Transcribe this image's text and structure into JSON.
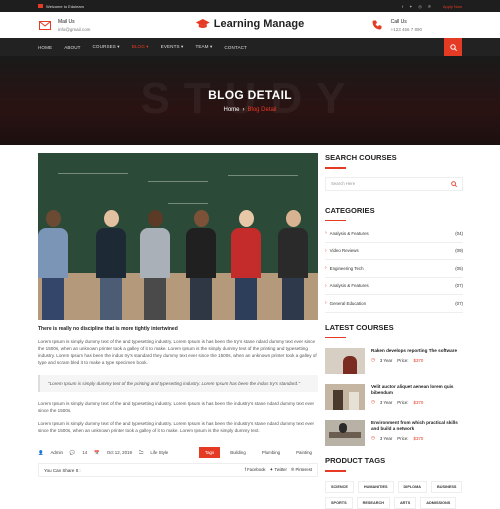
{
  "topbar": {
    "welcome": "Welcome to Eduleam",
    "apply": "Apply Now",
    "social_icons": [
      "facebook-icon",
      "twitter-icon",
      "instagram-icon",
      "pinterest-icon"
    ]
  },
  "header": {
    "mail_label": "Mail Us",
    "mail_value": "info@gmail.com",
    "logo": "Learning Manage",
    "call_label": "Call Us",
    "call_value": "+123 456 7 890"
  },
  "nav": {
    "items": [
      "HOME",
      "ABOUT",
      "COURSES ▾",
      "BLOG ▾",
      "EVENTS ▾",
      "TEAM ▾",
      "CONTACT"
    ],
    "active_index": 3
  },
  "hero": {
    "ghost": "STUDY",
    "title": "BLOG DETAIL",
    "crumb_home": "Home",
    "crumb_sep": "›",
    "crumb_current": "Blog Detail"
  },
  "post": {
    "title": "There is really no discipline that is more tightly intertwined",
    "p1": "Lorem Ipsum is simply dummy text of the and typesetting industry. Lorem Ipsum is has been the try's stane ndard dummy text ever since the 1500s, when an unknown printer took a galley of it to make. Lorem Ipsum is the simply dummy text of the printing and typesetting industry. Lorem Ipsum has been the indus try's standard they dummy text ever since the 1500s, when an unknown printer took a galley of type and scram bled it to make a type specimen book.",
    "quote": "\"Lorem Ipsum is simply dummy text of the printing and typesetting industry. Lorem Ipsum has been the indus try's standard.\"",
    "p2": "Lorem Ipsum is simply dummy text of the and typesetting industry. Lorem Ipsum is has been the industry's stane ndard dummy text ever since the 1500s.",
    "p3": "Lorem Ipsum is simply dummy text of the and typesetting industry. Lorem Ipsum is has been the industry's stane ndard dummy text ever since the 1500s, when an unknown printer took a galley of it to make. Lorem Ipsum is the simply dummy text.",
    "author": "Admin",
    "comments": "14",
    "date": "Oct 12, 2019",
    "category": "Life Style",
    "tags": [
      "Tags",
      "Building",
      "Plumbing",
      "Painting"
    ],
    "share_label": "You Can Share It :",
    "share_buttons": [
      "Facebook",
      "Twitter",
      "Pinterest"
    ]
  },
  "sidebar": {
    "search_title": "SEARCH COURSES",
    "search_placeholder": "Search Here",
    "categories_title": "CATEGORIES",
    "categories": [
      {
        "name": "Analysis & Features",
        "count": "(04)"
      },
      {
        "name": "Video Reviews",
        "count": "(09)"
      },
      {
        "name": "Engineering Tech",
        "count": "(05)"
      },
      {
        "name": "Analysis & Features",
        "count": "(07)"
      },
      {
        "name": "General Education",
        "count": "(07)"
      }
    ],
    "latest_title": "LATEST COURSES",
    "courses": [
      {
        "title": "Raken develops reporting The software",
        "duration": "3 Year",
        "price_label": "Price:",
        "price": "$370"
      },
      {
        "title": "Velit auctor aliquet aenean lorem quis bibendum",
        "duration": "3 Year",
        "price_label": "Price:",
        "price": "$370"
      },
      {
        "title": "Environment from which practical skills and build a network",
        "duration": "3 Year",
        "price_label": "Price:",
        "price": "$370"
      }
    ],
    "tags_title": "PRODUCT TAGS",
    "tags": [
      "SCIENCE",
      "HUMANITIES",
      "DIPLOMA",
      "BUSINESS",
      "SPORTS",
      "RESEARCH",
      "ARTS",
      "ADMISSIONS"
    ]
  },
  "colors": {
    "accent": "#e53a23",
    "nav_bg": "#222222",
    "topbar_bg": "#1e1e1e"
  }
}
